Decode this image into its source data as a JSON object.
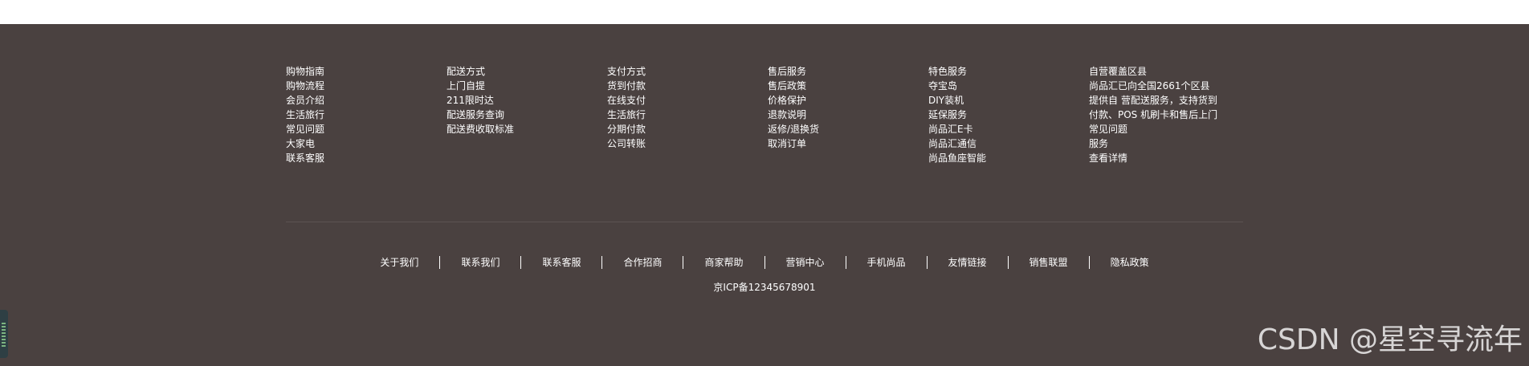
{
  "columns": [
    {
      "items": [
        "购物指南",
        "购物流程",
        "会员介绍",
        "生活旅行",
        "常见问题",
        "大家电",
        "联系客服"
      ]
    },
    {
      "items": [
        "配送方式",
        "上门自提",
        "211限时达",
        "配送服务查询",
        "配送费收取标准"
      ]
    },
    {
      "items": [
        "支付方式",
        "货到付款",
        "在线支付",
        "生活旅行",
        "分期付款",
        "公司转账"
      ]
    },
    {
      "items": [
        "售后服务",
        "售后政策",
        "价格保护",
        "退款说明",
        "返修/退换货",
        "取消订单"
      ]
    },
    {
      "items": [
        "特色服务",
        "夺宝岛",
        "DIY装机",
        "延保服务",
        "尚品汇E卡",
        "尚品汇通信",
        "尚品鱼座智能"
      ]
    },
    {
      "title": "自营覆盖区县",
      "description": "尚品汇已向全国2661个区县提供自 营配送服务，支持货到付款、POS 机刷卡和售后上门服务，",
      "line_a": "尚品汇已向全国2661个区县",
      "line_b": "提供自 营配送服务，支持货到",
      "line_c": "付款、POS 机刷卡和售后上门",
      "faq": "常见问题",
      "service": "服务",
      "more": "查看详情"
    }
  ],
  "bottom_links": [
    "关于我们",
    "联系我们",
    "联系客服",
    "合作招商",
    "商家帮助",
    "营销中心",
    "手机尚品",
    "友情链接",
    "销售联盟",
    "隐私政策"
  ],
  "icp": "京ICP备12345678901",
  "watermark": "CSDN @星空寻流年",
  "colors": {
    "footer_bg": "#4a4140",
    "text": "#ffffff"
  }
}
